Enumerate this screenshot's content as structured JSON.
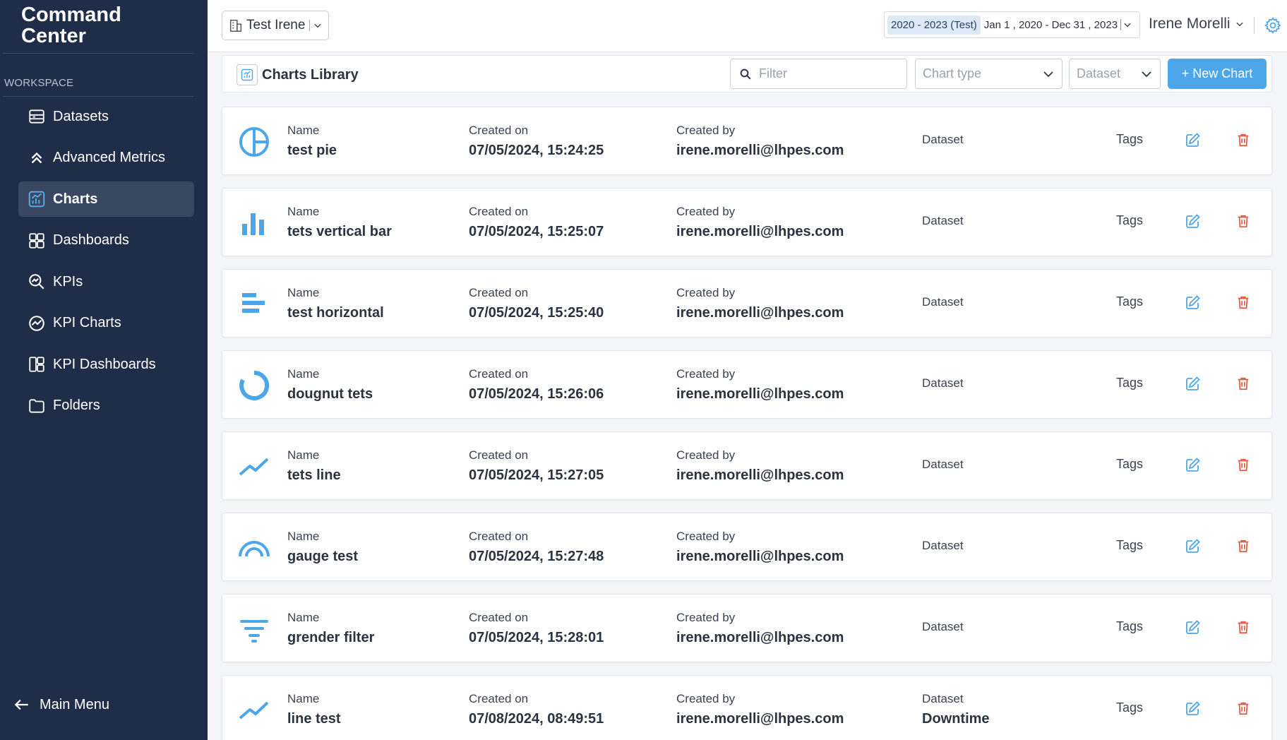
{
  "sidebar": {
    "brand": "Command Center",
    "section_label": "WORKSPACE",
    "items": [
      {
        "label": "Datasets",
        "icon": "datasets-icon"
      },
      {
        "label": "Advanced Metrics",
        "icon": "double-chevron-up-icon"
      },
      {
        "label": "Charts",
        "icon": "chart-icon",
        "active": true
      },
      {
        "label": "Dashboards",
        "icon": "dashboard-icon"
      },
      {
        "label": "KPIs",
        "icon": "kpi-search-icon"
      },
      {
        "label": "KPI Charts",
        "icon": "kpi-chart-icon"
      },
      {
        "label": "KPI Dashboards",
        "icon": "kpi-dashboard-icon"
      },
      {
        "label": "Folders",
        "icon": "folder-icon"
      }
    ],
    "main_menu": "Main Menu"
  },
  "topbar": {
    "org": "Test Irene",
    "date_chip": "2020 - 2023 (Test)",
    "date_range": "Jan 1 , 2020 - Dec 31 , 2023",
    "user": "Irene Morelli"
  },
  "library": {
    "title": "Charts Library",
    "filter_placeholder": "Filter",
    "chart_type_placeholder": "Chart type",
    "dataset_placeholder": "Dataset",
    "new_chart_label": "+ New Chart"
  },
  "labels": {
    "name": "Name",
    "created_on": "Created on",
    "created_by": "Created by",
    "dataset": "Dataset",
    "tags": "Tags"
  },
  "charts": [
    {
      "icon": "pie",
      "name": "test pie",
      "created_on": "07/05/2024, 15:24:25",
      "created_by": "irene.morelli@lhpes.com",
      "dataset": ""
    },
    {
      "icon": "vertical-bar",
      "name": "tets vertical bar",
      "created_on": "07/05/2024, 15:25:07",
      "created_by": "irene.morelli@lhpes.com",
      "dataset": ""
    },
    {
      "icon": "horizontal-bar",
      "name": "test horizontal",
      "created_on": "07/05/2024, 15:25:40",
      "created_by": "irene.morelli@lhpes.com",
      "dataset": ""
    },
    {
      "icon": "doughnut",
      "name": "dougnut tets",
      "created_on": "07/05/2024, 15:26:06",
      "created_by": "irene.morelli@lhpes.com",
      "dataset": ""
    },
    {
      "icon": "line",
      "name": "tets line",
      "created_on": "07/05/2024, 15:27:05",
      "created_by": "irene.morelli@lhpes.com",
      "dataset": ""
    },
    {
      "icon": "gauge",
      "name": "gauge test",
      "created_on": "07/05/2024, 15:27:48",
      "created_by": "irene.morelli@lhpes.com",
      "dataset": ""
    },
    {
      "icon": "filter",
      "name": "grender filter",
      "created_on": "07/05/2024, 15:28:01",
      "created_by": "irene.morelli@lhpes.com",
      "dataset": ""
    },
    {
      "icon": "line",
      "name": "line test",
      "created_on": "07/08/2024, 08:49:51",
      "created_by": "irene.morelli@lhpes.com",
      "dataset": "Downtime"
    }
  ],
  "colors": {
    "sidebar_bg": "#1f2d49",
    "accent": "#4ea6ea",
    "delete": "#e5533d"
  }
}
